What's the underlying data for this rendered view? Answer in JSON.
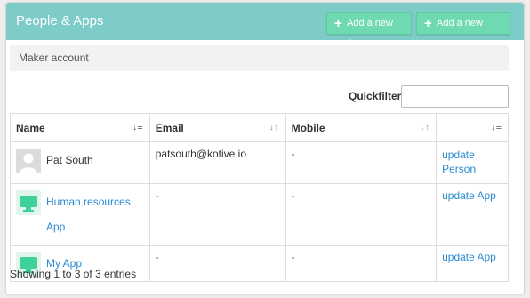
{
  "header": {
    "title": "People & Apps",
    "add_app_label": "Add a new App",
    "add_person_label": "Add a new person"
  },
  "maker_label": "Maker account",
  "quickfilter": {
    "label": "Quickfilter:",
    "value": ""
  },
  "table": {
    "columns": [
      "Name",
      "Email",
      "Mobile",
      ""
    ],
    "rows": [
      {
        "name": "Pat South",
        "email": "patsouth@kotive.io",
        "mobile": "-",
        "action_line1": "update",
        "action_line2": "Person",
        "icon": "person-avatar-icon"
      },
      {
        "name": "Human resources App",
        "email": "-",
        "mobile": "-",
        "action": "update App",
        "icon": "app-monitor-icon"
      },
      {
        "name": "My App",
        "email": "-",
        "mobile": "-",
        "action": "update App",
        "icon": "app-monitor-icon"
      }
    ]
  },
  "footer": "Showing 1 to 3 of 3 entries",
  "colors": {
    "header": "#7dccc8",
    "button": "#6fd9b1",
    "link": "#2a8bd1",
    "app_icon": "#3fd19a"
  }
}
